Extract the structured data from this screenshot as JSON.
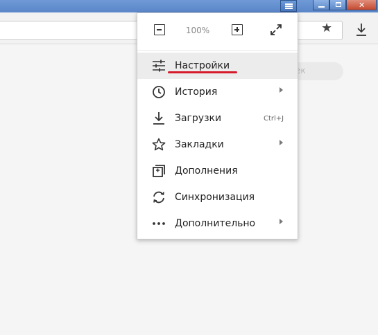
{
  "zoom": {
    "level": "100%"
  },
  "menu": {
    "items": [
      {
        "label": "Настройки",
        "icon": "settings-sliders-icon"
      },
      {
        "label": "История",
        "icon": "clock-icon",
        "submenu": true
      },
      {
        "label": "Загрузки",
        "icon": "download-icon",
        "shortcut": "Ctrl+J"
      },
      {
        "label": "Закладки",
        "icon": "star-outline-icon",
        "submenu": true
      },
      {
        "label": "Дополнения",
        "icon": "extensions-icon"
      },
      {
        "label": "Синхронизация",
        "icon": "sync-icon"
      },
      {
        "label": "Дополнительно",
        "icon": "more-dots-icon",
        "submenu": true
      }
    ]
  },
  "page": {
    "search_fragment": "ек"
  },
  "colors": {
    "titlebar": "#5a86c9",
    "highlight_red": "#d61a2a",
    "menu_hover": "#ececec"
  }
}
